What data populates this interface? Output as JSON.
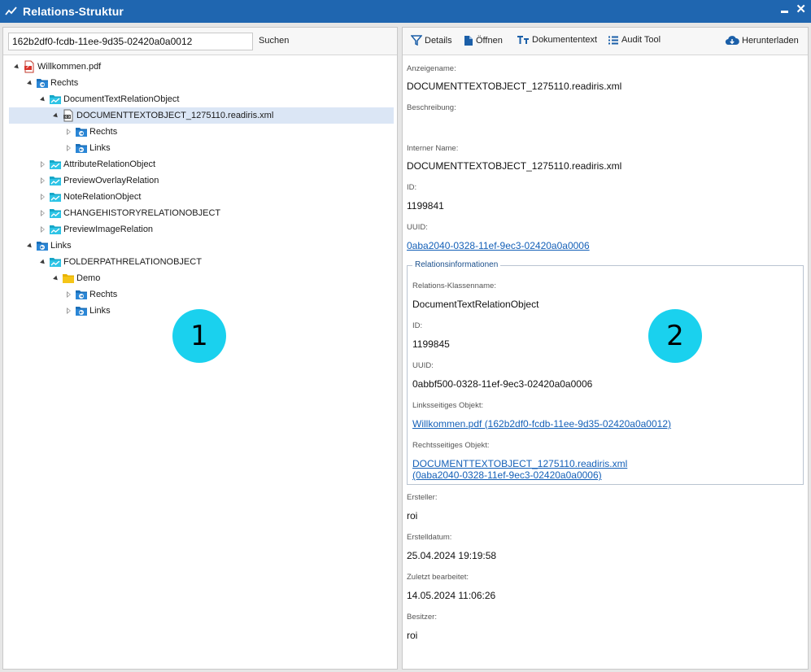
{
  "window": {
    "title": "Relations-Struktur"
  },
  "search": {
    "value": "162b2df0-fcdb-11ee-9d35-02420a0a0012",
    "button_label": "Suchen"
  },
  "tree": {
    "nodes": [
      {
        "label": "Willkommen.pdf"
      },
      {
        "label": "Rechts"
      },
      {
        "label": "DocumentTextRelationObject"
      },
      {
        "label": "DOCUMENTTEXTOBJECT_1275110.readiris.xml"
      },
      {
        "label": "Rechts"
      },
      {
        "label": "Links"
      },
      {
        "label": "AttributeRelationObject"
      },
      {
        "label": "PreviewOverlayRelation"
      },
      {
        "label": "NoteRelationObject"
      },
      {
        "label": "CHANGEHISTORYRELATIONOBJECT"
      },
      {
        "label": "PreviewImageRelation"
      },
      {
        "label": "Links"
      },
      {
        "label": "FOLDERPATHRELATIONOBJECT"
      },
      {
        "label": "Demo"
      },
      {
        "label": "Rechts"
      },
      {
        "label": "Links"
      }
    ]
  },
  "callouts": {
    "left": "1",
    "right": "2"
  },
  "toolbar": {
    "details": "Details",
    "open": "Öffnen",
    "doctext": "Dokumententext",
    "audit": "Audit Tool",
    "download": "Herunterladen"
  },
  "details": {
    "display_name_label": "Anzeigename:",
    "display_name": "DOCUMENTTEXTOBJECT_1275110.readiris.xml",
    "description_label": "Beschreibung:",
    "description": "",
    "internal_name_label": "Interner Name:",
    "internal_name": "DOCUMENTTEXTOBJECT_1275110.readiris.xml",
    "id_label": "ID:",
    "id": "1199841",
    "uuid_label": "UUID:",
    "uuid": "0aba2040-0328-11ef-9ec3-02420a0a0006",
    "relation": {
      "legend": "Relationsinformationen",
      "class_label": "Relations-Klassenname:",
      "class_name": "DocumentTextRelationObject",
      "id_label": "ID:",
      "id": "1199845",
      "uuid_label": "UUID:",
      "uuid": "0abbf500-0328-11ef-9ec3-02420a0a0006",
      "left_label": "Linksseitiges Objekt:",
      "left_object": "Willkommen.pdf (162b2df0-fcdb-11ee-9d35-02420a0a0012)",
      "right_label": "Rechtsseitiges Objekt:",
      "right_object_line1": "DOCUMENTTEXTOBJECT_1275110.readiris.xml",
      "right_object_line2": "(0aba2040-0328-11ef-9ec3-02420a0a0006)"
    },
    "creator_label": "Ersteller:",
    "creator": "roi",
    "created_label": "Erstelldatum:",
    "created": "25.04.2024 19:19:58",
    "modified_label": "Zuletzt bearbeitet:",
    "modified": "14.05.2024 11:06:26",
    "owner_label": "Besitzer:",
    "owner": "roi"
  },
  "colors": {
    "titlebar": "#1f66b0",
    "selection": "#dbe6f5",
    "callout": "#1ad1ee",
    "link": "#1460b8"
  }
}
